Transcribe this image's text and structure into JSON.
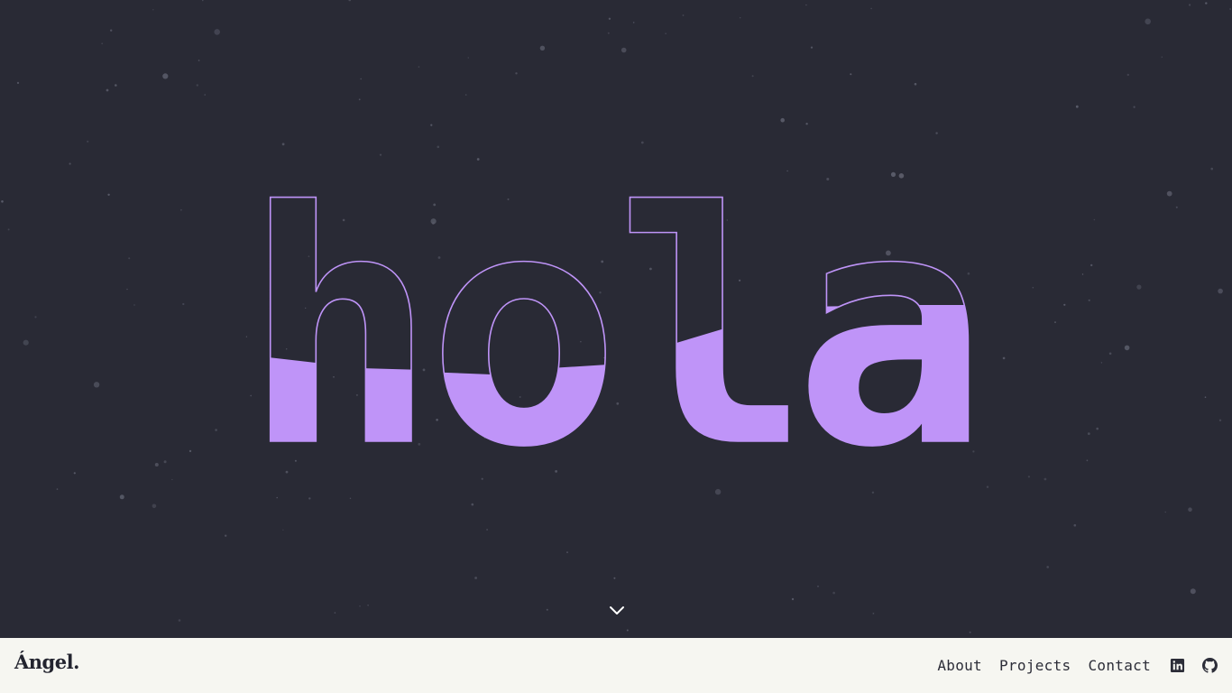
{
  "hero": {
    "greeting": "hola",
    "accent_color": "#bf94f8",
    "background_color": "#292a35",
    "scroll_icon": "chevron-down-icon"
  },
  "navbar": {
    "logo": "Ángel.",
    "links": [
      {
        "label": "About"
      },
      {
        "label": "Projects"
      },
      {
        "label": "Contact"
      }
    ],
    "social": [
      {
        "icon": "linkedin-icon"
      },
      {
        "icon": "github-icon"
      }
    ],
    "background_color": "#f6f6f1"
  }
}
